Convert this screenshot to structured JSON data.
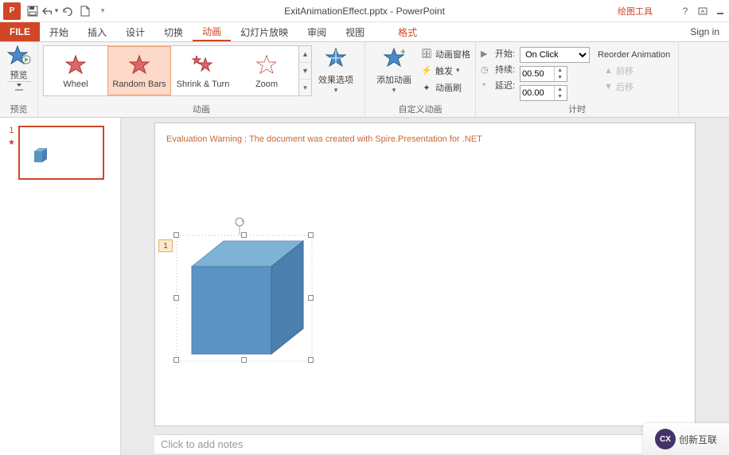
{
  "titlebar": {
    "app_icon": "P",
    "filename": "ExitAnimationEffect.pptx - PowerPoint",
    "context_tab": "绘图工具"
  },
  "tabs": {
    "file": "FILE",
    "items": [
      "开始",
      "插入",
      "设计",
      "切换",
      "动画",
      "幻灯片放映",
      "审阅",
      "视图"
    ],
    "format": "格式",
    "signin": "Sign in",
    "active_index": 4
  },
  "ribbon": {
    "preview": {
      "label": "预览",
      "footer": "预览"
    },
    "gallery": {
      "items": [
        "Wheel",
        "Random Bars",
        "Shrink & Turn",
        "Zoom"
      ],
      "selected_index": 1,
      "footer": "动画"
    },
    "effect_options": "效果选项",
    "add_animation": "添加动画",
    "advanced": {
      "pane": "动画窗格",
      "trigger": "触发",
      "painter": "动画刷",
      "footer": "自定义动画"
    },
    "timing": {
      "start_label": "开始:",
      "start_value": "On Click",
      "duration_label": "持续:",
      "duration_value": "00.50",
      "delay_label": "延迟:",
      "delay_value": "00.00",
      "footer": "计时"
    },
    "reorder": {
      "title": "Reorder Animation",
      "earlier": "前移",
      "later": "后移"
    }
  },
  "thumbs": {
    "slide_number": "1"
  },
  "slide": {
    "warning": "Evaluation Warning : The document was created with  Spire.Presentation for .NET",
    "anim_index": "1"
  },
  "notes": {
    "placeholder": "Click to add notes"
  },
  "watermark": {
    "logo": "CX",
    "text": "创新互联"
  },
  "chart_data": {
    "type": "table",
    "note": "no chart in image"
  }
}
